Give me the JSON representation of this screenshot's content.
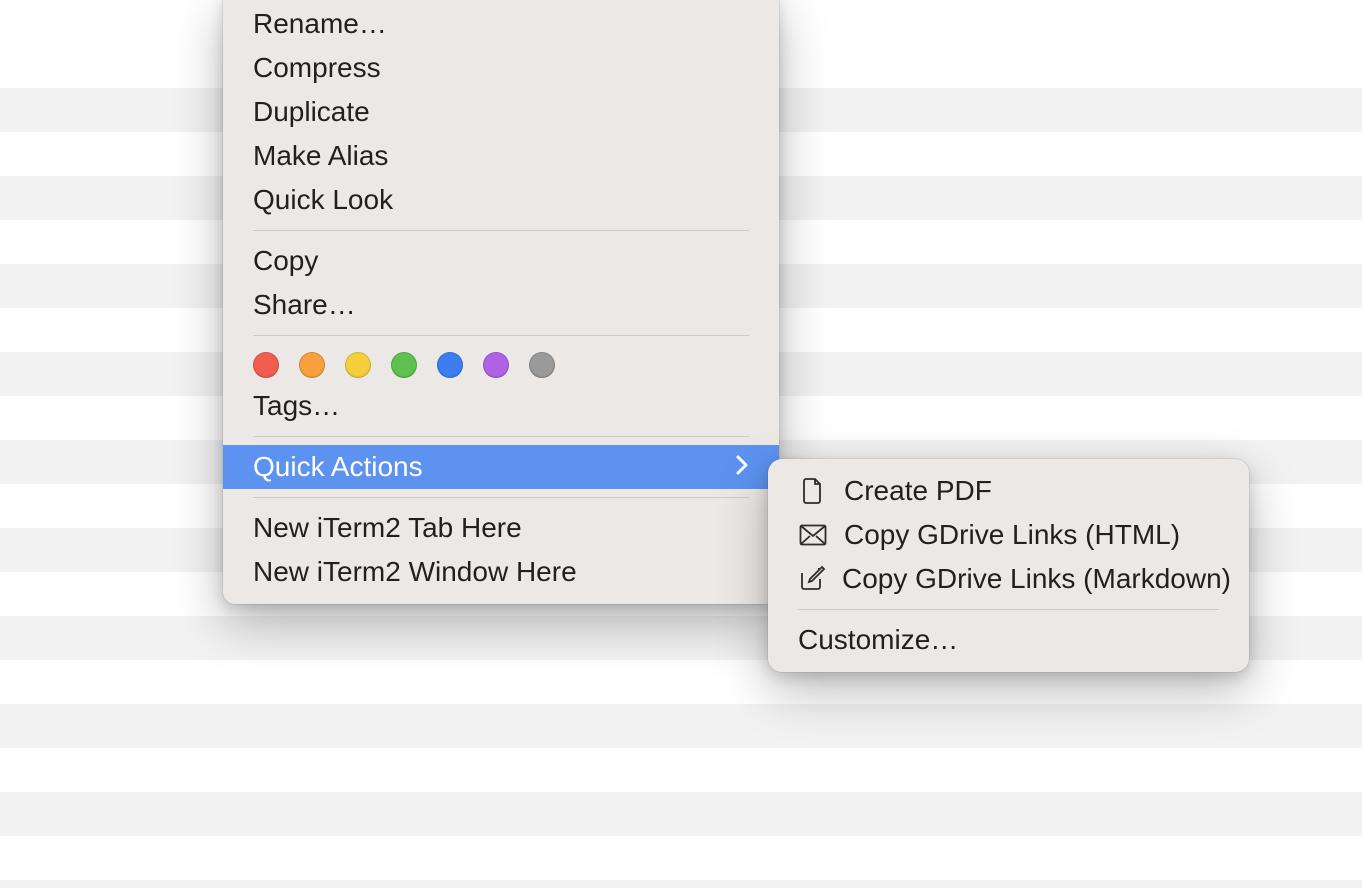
{
  "menu": {
    "group1": [
      {
        "id": "rename",
        "label": "Rename…"
      },
      {
        "id": "compress",
        "label": "Compress"
      },
      {
        "id": "duplicate",
        "label": "Duplicate"
      },
      {
        "id": "make-alias",
        "label": "Make Alias"
      },
      {
        "id": "quick-look",
        "label": "Quick Look"
      }
    ],
    "group2": [
      {
        "id": "copy",
        "label": "Copy"
      },
      {
        "id": "share",
        "label": "Share…"
      }
    ],
    "tags": {
      "colors": [
        "#f35d4f",
        "#f7a03c",
        "#f5ce3c",
        "#5ec14f",
        "#3e7cf2",
        "#b062e5",
        "#9a9a9a"
      ],
      "label": "Tags…"
    },
    "quick_actions": {
      "label": "Quick Actions",
      "items": [
        {
          "id": "create-pdf",
          "icon": "document-icon",
          "label": "Create PDF"
        },
        {
          "id": "copy-gdrive-html",
          "icon": "envelope-icon",
          "label": "Copy GDrive Links (HTML)"
        },
        {
          "id": "copy-gdrive-md",
          "icon": "compose-icon",
          "label": "Copy GDrive Links (Markdown)"
        }
      ],
      "customize": "Customize…"
    },
    "group3": [
      {
        "id": "iterm-tab",
        "label": "New iTerm2 Tab Here"
      },
      {
        "id": "iterm-window",
        "label": "New iTerm2 Window Here"
      }
    ]
  }
}
